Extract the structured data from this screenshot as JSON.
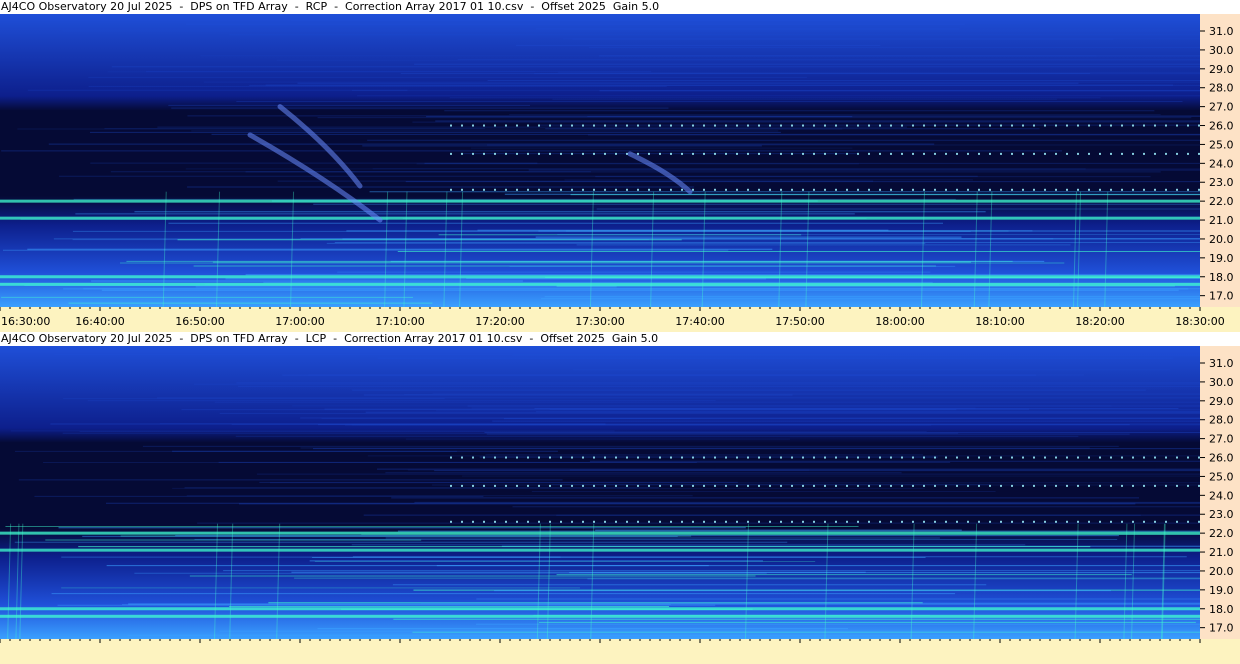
{
  "chart_data": [
    {
      "type": "heatmap",
      "title": "AJ4CO Observatory 20 Jul 2025  -  DPS on TFD Array  -  RCP  -  Correction Array 2017 01 10.csv  -  Offset 2025  Gain 5.0",
      "y_ticks": [
        "17.0",
        "18.0",
        "19.0",
        "20.0",
        "21.0",
        "22.0",
        "23.0",
        "24.0",
        "25.0",
        "26.0",
        "27.0",
        "28.0",
        "29.0",
        "30.0",
        "31.0"
      ],
      "y_values": [
        17.0,
        18.0,
        19.0,
        20.0,
        21.0,
        22.0,
        23.0,
        24.0,
        25.0,
        26.0,
        27.0,
        28.0,
        29.0,
        30.0,
        31.0
      ],
      "ylim": [
        16.4,
        31.9
      ],
      "x_ticks": [
        "16:30:00",
        "16:40:00",
        "16:50:00",
        "17:00:00",
        "17:10:00",
        "17:20:00",
        "17:30:00",
        "17:40:00",
        "17:50:00",
        "18:00:00",
        "18:10:00",
        "18:20:00",
        "18:30:00"
      ],
      "x_minutes": [
        0,
        10,
        20,
        30,
        40,
        50,
        60,
        70,
        80,
        90,
        100,
        110,
        120
      ],
      "features": {
        "bright_bands": [
          17.6,
          18.0,
          21.1,
          22.0
        ],
        "drift_bursts": [
          {
            "start": "16:58:00",
            "f_high": 27.0,
            "end": "17:06:00",
            "f_low": 22.8
          },
          {
            "start": "16:55:00",
            "f_high": 25.5,
            "end": "17:08:00",
            "f_low": 21.0
          },
          {
            "start": "17:33:00",
            "f_high": 24.5,
            "end": "17:39:00",
            "f_low": 22.5
          }
        ],
        "dotted_carriers": [
          22.6,
          24.5,
          26.0
        ]
      }
    },
    {
      "type": "heatmap",
      "title": "AJ4CO Observatory 20 Jul 2025  -  DPS on TFD Array  -  LCP  -  Correction Array 2017 01 10.csv  -  Offset 2025  Gain 5.0",
      "y_ticks": [
        "17.0",
        "18.0",
        "19.0",
        "20.0",
        "21.0",
        "22.0",
        "23.0",
        "24.0",
        "25.0",
        "26.0",
        "27.0",
        "28.0",
        "29.0",
        "30.0",
        "31.0"
      ],
      "y_values": [
        17.0,
        18.0,
        19.0,
        20.0,
        21.0,
        22.0,
        23.0,
        24.0,
        25.0,
        26.0,
        27.0,
        28.0,
        29.0,
        30.0,
        31.0
      ],
      "ylim": [
        16.4,
        31.9
      ],
      "x_ticks": [],
      "x_minutes": [
        0,
        10,
        20,
        30,
        40,
        50,
        60,
        70,
        80,
        90,
        100,
        110,
        120
      ],
      "features": {
        "bright_bands": [
          17.6,
          18.0,
          21.1,
          22.0
        ],
        "drift_bursts": [],
        "dotted_carriers": [
          22.6,
          24.5,
          26.0
        ]
      }
    }
  ],
  "colors": {
    "deep": "#050a35",
    "low": "#0d1f8c",
    "mid": "#1f4fd8",
    "high": "#3aa0ff",
    "hot": "#40ffd0",
    "freq_axis_bg": "#fde2c6",
    "time_axis_bg": "#fdf3c0"
  }
}
